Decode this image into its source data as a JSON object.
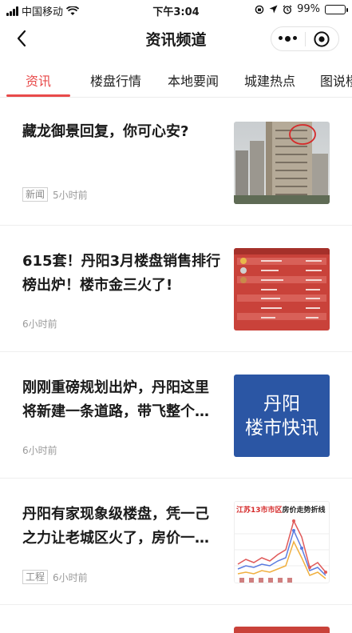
{
  "status_bar": {
    "carrier": "中国移动",
    "time": "下午3:04",
    "battery": "99%",
    "battery_level": 0.99
  },
  "header": {
    "title": "资讯频道"
  },
  "tabs": [
    {
      "label": "资讯"
    },
    {
      "label": "楼盘行情"
    },
    {
      "label": "本地要闻"
    },
    {
      "label": "城建热点"
    },
    {
      "label": "图说楼"
    }
  ],
  "articles": [
    {
      "title": "藏龙御景回复，你可心安?",
      "tag": "新闻",
      "time": "5小时前"
    },
    {
      "title": "615套！丹阳3月楼盘销售排行榜出炉！楼市金三火了!",
      "time": "6小时前"
    },
    {
      "title": "刚刚重磅规划出炉，丹阳这里将新建一条道路，带飞整个…",
      "time": "6小时前",
      "thumb_line1": "丹阳",
      "thumb_line2": "楼市快讯"
    },
    {
      "title": "丹阳有家现象级楼盘，凭一己之力让老城区火了，房价一…",
      "tag": "工程",
      "time": "6小时前",
      "thumb_heading_red": "江苏13市市区",
      "thumb_heading_rest": "房价走势折线"
    }
  ],
  "colors": {
    "accent": "#e84a4a",
    "thumb_blue": "#2b56a4"
  }
}
